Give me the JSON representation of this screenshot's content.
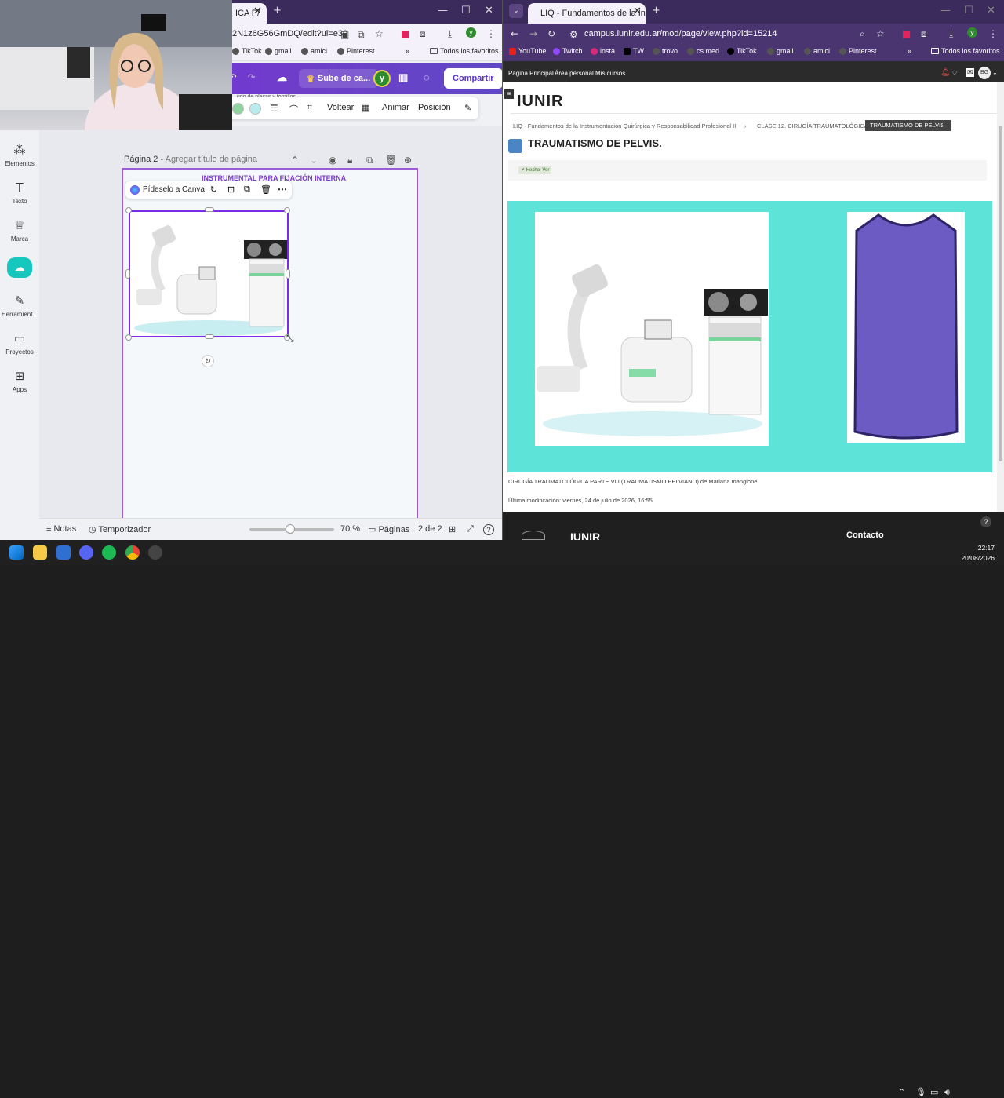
{
  "left_browser": {
    "tab_title": "ICA P/",
    "url": "2N1z6G56GmDQ/edit?ui=e30",
    "bookmarks": [
      "TikTok",
      "gmail",
      "amici",
      "Pinterest"
    ],
    "bookmarks_folder": "Todos los favoritos"
  },
  "canva": {
    "share_to_label": "Sube de ca...",
    "avatar_letter": "y",
    "share_label": "Compartir",
    "toolbar": {
      "flip": "Voltear",
      "animate": "Animar",
      "position": "Posición"
    },
    "partial_text": "...udo de placas y tornillos",
    "sidebar": [
      {
        "label": "Elementos",
        "icon": "elements-icon"
      },
      {
        "label": "Texto",
        "icon": "text-icon"
      },
      {
        "label": "Marca",
        "icon": "brand-icon"
      },
      {
        "label": "Herramient...",
        "icon": "tools-icon"
      },
      {
        "label": "Proyectos",
        "icon": "folder-icon"
      },
      {
        "label": "Apps",
        "icon": "apps-icon"
      }
    ],
    "page_label": "Página 2 -",
    "page_title_placeholder": "Agregar título de página",
    "page_heading": "INSTRUMENTAL PARA FIJACIÓN INTERNA",
    "ask_canva": "Pídeselo a Canva",
    "bottom": {
      "notes": "Notas",
      "timer": "Temporizador",
      "zoom": "70 %",
      "zoom_fraction": 0.48,
      "pages": "Páginas",
      "page_count": "2 de 2"
    },
    "accent": "#7d2ae8"
  },
  "right_browser": {
    "tab_title": "LIQ - Fundamentos de la Instru",
    "url": "campus.iunir.edu.ar/mod/page/view.php?id=15214",
    "bookmarks": [
      "YouTube",
      "Twitch",
      "insta",
      "TW",
      "trovo",
      "cs med",
      "TikTok",
      "gmail",
      "amici",
      "Pinterest"
    ],
    "bookmarks_folder": "Todos los favoritos",
    "nav": [
      "Página Principal",
      "Área personal",
      "Mis cursos"
    ],
    "user_initials": "BG",
    "logo": "IUNIR",
    "breadcrumb": [
      "LIQ - Fundamentos de la Instrumentación Quirúrgica y Responsabilidad Profesional II",
      "CLASE 12. CIRUGÍA TRAUMATOLÓGICA"
    ],
    "breadcrumb_active": "TRAUMATISMO DE PELVIS.",
    "heading": "TRAUMATISMO DE PELVIS.",
    "done_badge": "✔ Hecho: Ver",
    "caption": "CIRUGÍA TRAUMATOLÓGICA PARTE VIII (TRAUMATISMO PELVIANO) de Mariana mangione",
    "modified": "Última modificación: viernes, 24 de julio de 2026, 16:55",
    "footer_contact": "Contacto",
    "panel_color": "#5ee3d9"
  },
  "taskbar": {
    "time": "22:17",
    "date": "20/08/2026"
  }
}
